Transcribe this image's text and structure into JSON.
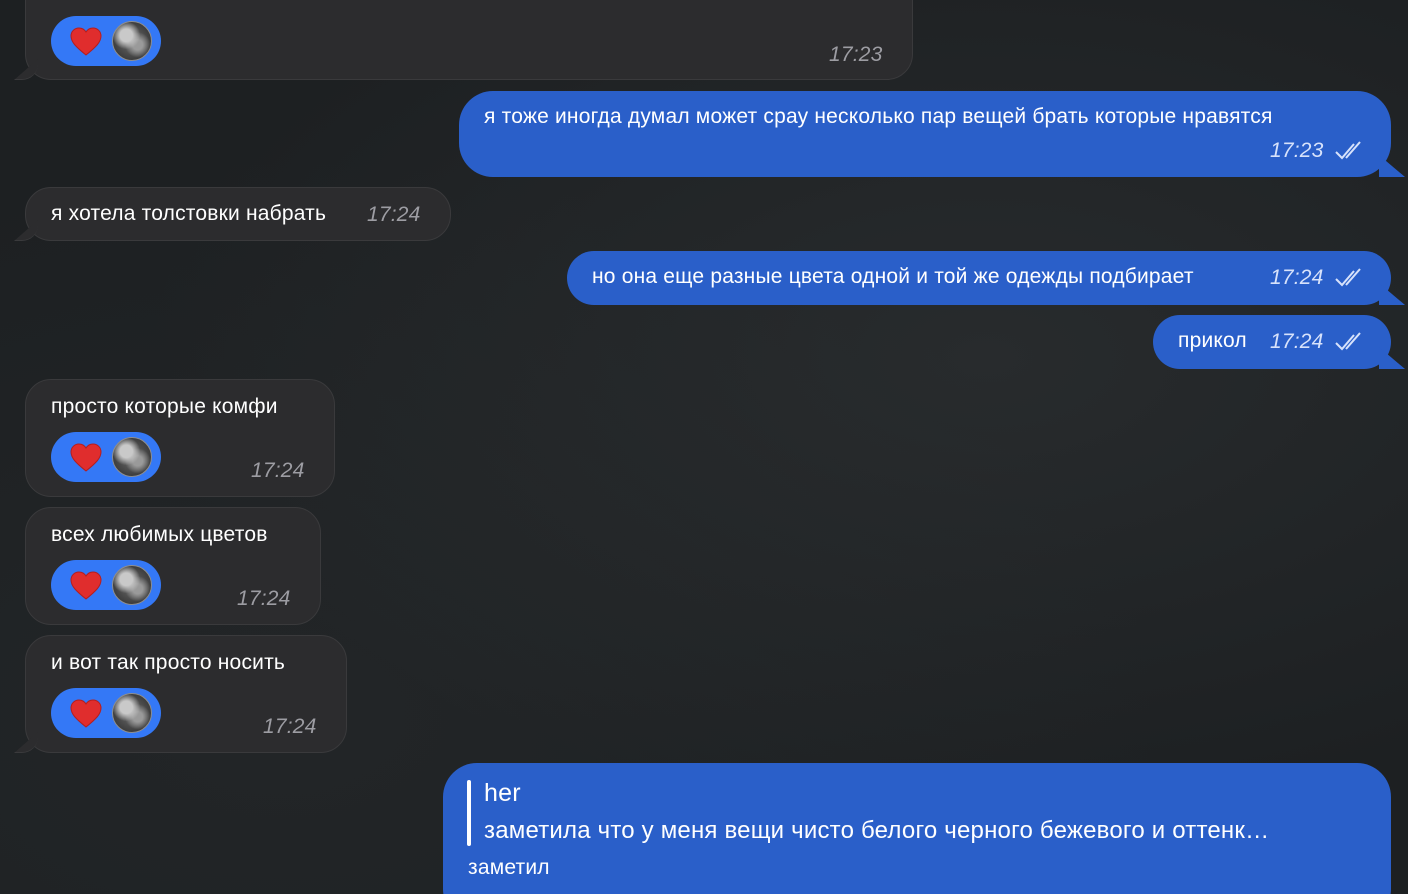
{
  "colors": {
    "background": "#1d2022",
    "incoming_bubble": "#2c2c2e",
    "outgoing_bubble": "#2a5fc9",
    "reaction_pill": "#3478f6",
    "heart": "#e02d2d"
  },
  "messages": [
    {
      "direction": "in",
      "time": "17:23",
      "reaction": {
        "emoji": "heart-icon",
        "avatar": "avatar"
      }
    },
    {
      "direction": "out",
      "text": "я тоже иногда думал может срау несколько пар вещей брать которые нравятся",
      "time": "17:23",
      "status": "read"
    },
    {
      "direction": "in",
      "text": "я хотела толстовки набрать",
      "time": "17:24"
    },
    {
      "direction": "out",
      "text": "но она еще разные цвета одной и той же одежды подбирает",
      "time": "17:24",
      "status": "read"
    },
    {
      "direction": "out",
      "text": "прикол",
      "time": "17:24",
      "status": "read"
    },
    {
      "direction": "in",
      "text": "просто которые комфи",
      "time": "17:24",
      "reaction": {
        "emoji": "heart-icon",
        "avatar": "avatar"
      }
    },
    {
      "direction": "in",
      "text": "всех любимых цветов",
      "time": "17:24",
      "reaction": {
        "emoji": "heart-icon",
        "avatar": "avatar"
      }
    },
    {
      "direction": "in",
      "text": "и вот так просто носить",
      "time": "17:24",
      "reaction": {
        "emoji": "heart-icon",
        "avatar": "avatar"
      }
    },
    {
      "direction": "out",
      "reply": {
        "author": "her",
        "quote": "заметила что у меня вещи чисто белого черного бежевого и оттенк…"
      },
      "text": "заметил"
    }
  ]
}
